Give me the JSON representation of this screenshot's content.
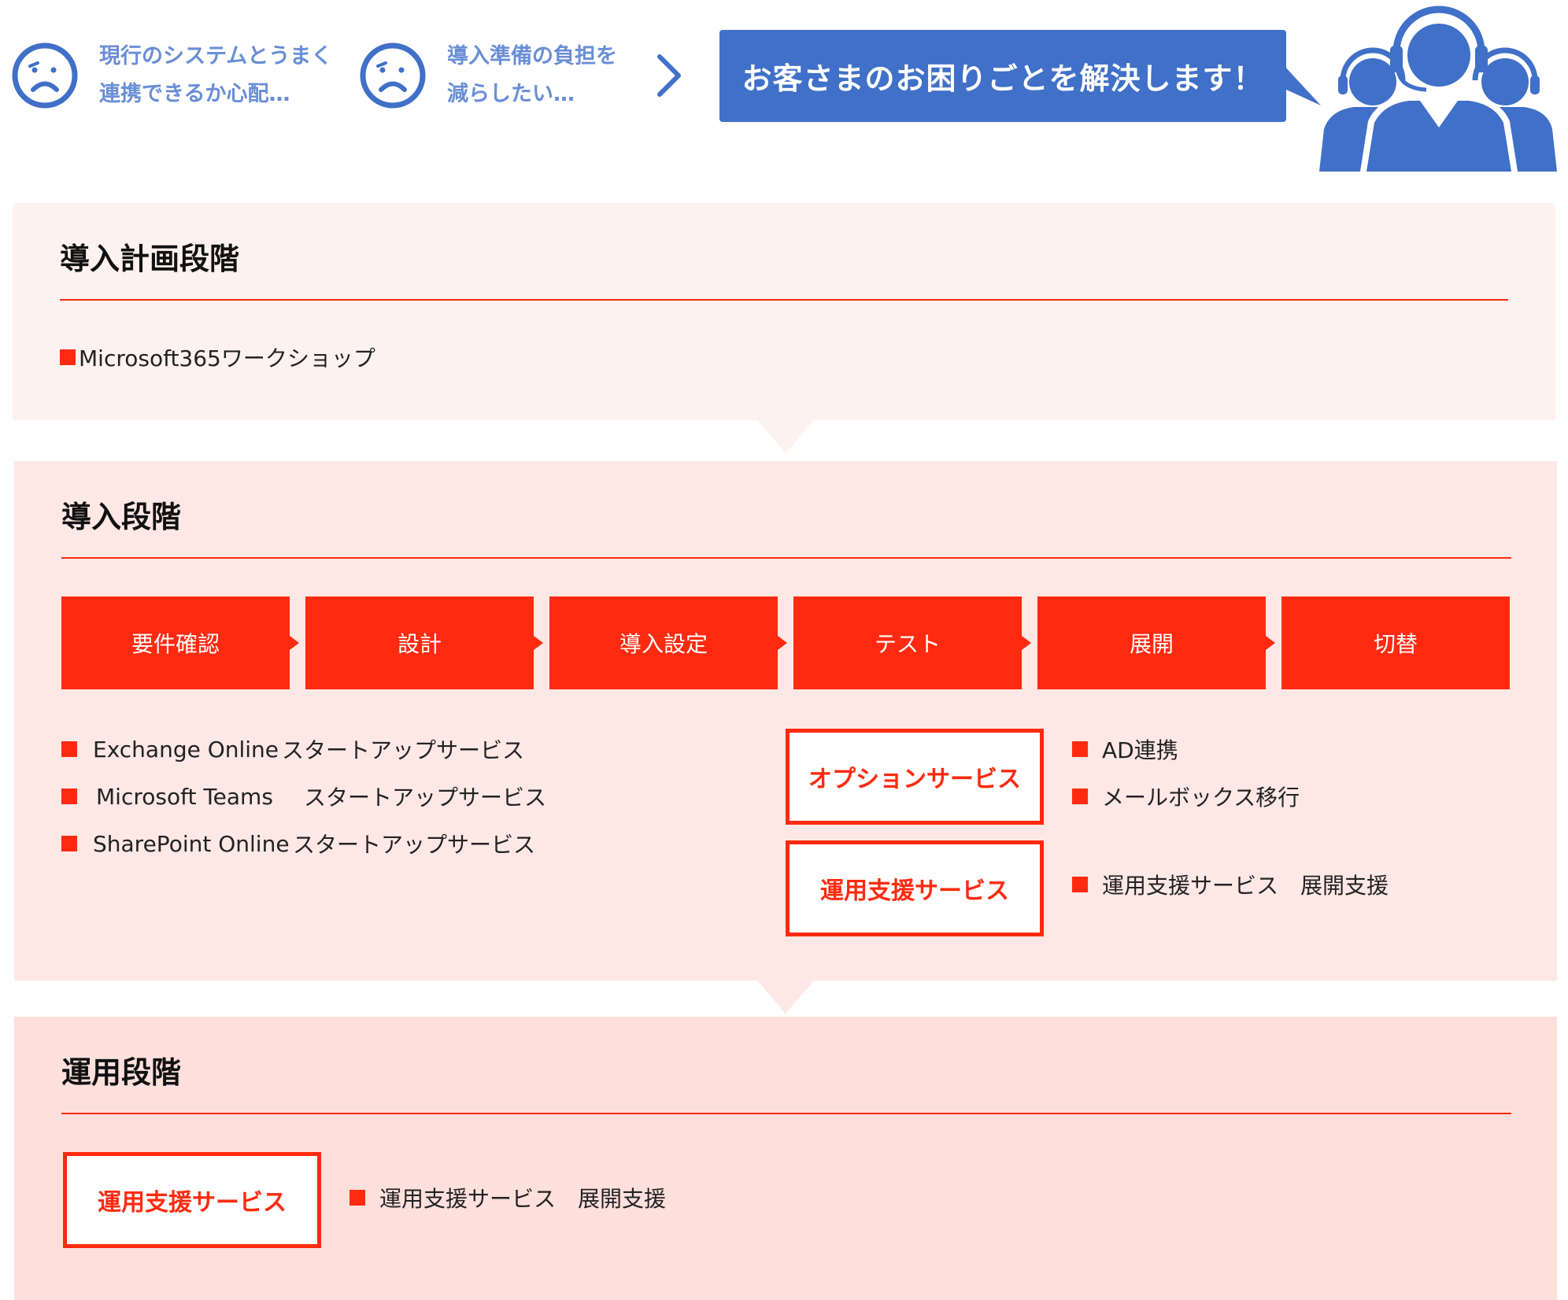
{
  "banner": {
    "worry1": {
      "line1": "現行のシステムとうまく",
      "line2": "連携できるか心配…",
      "icon": "sad-face-icon"
    },
    "worry2": {
      "line1": "導入準備の負担を",
      "line2": "減らしたい…",
      "icon": "sad-face-icon"
    },
    "arrow_icon": "chevron-right-icon",
    "message": "お客さまのお困りごとを解決します！",
    "support_icon": "support-team-icon"
  },
  "stage1": {
    "title": "導入計画段階",
    "items": [
      "Microsoft365ワークショップ"
    ]
  },
  "stage2": {
    "title": "導入段階",
    "steps": [
      "要件確認",
      "設計",
      "導入設定",
      "テスト",
      "展開",
      "切替"
    ],
    "startup_services": [
      {
        "product": "Exchange Online",
        "service": "スタートアップサービス"
      },
      {
        "product": "Microsoft Teams",
        "service": "スタートアップサービス"
      },
      {
        "product": "SharePoint Online",
        "service": "スタートアップサービス"
      }
    ],
    "option_label": "オプションサービス",
    "option_items": [
      "AD連携",
      "メールボックス移行"
    ],
    "support_label": "運用支援サービス",
    "support_item": "運用支援サービス　展開支援"
  },
  "stage3": {
    "title": "運用段階",
    "support_label": "運用支援サービス",
    "support_item": "運用支援サービス　展開支援"
  },
  "colors": {
    "accent_red": "#ff2a10",
    "banner_blue": "#4070c8",
    "worry_text_blue": "#6a8ed6",
    "stage1_bg": "#fef2f0",
    "stage2_bg": "#fde8e5",
    "stage3_bg": "#fde0dc"
  }
}
